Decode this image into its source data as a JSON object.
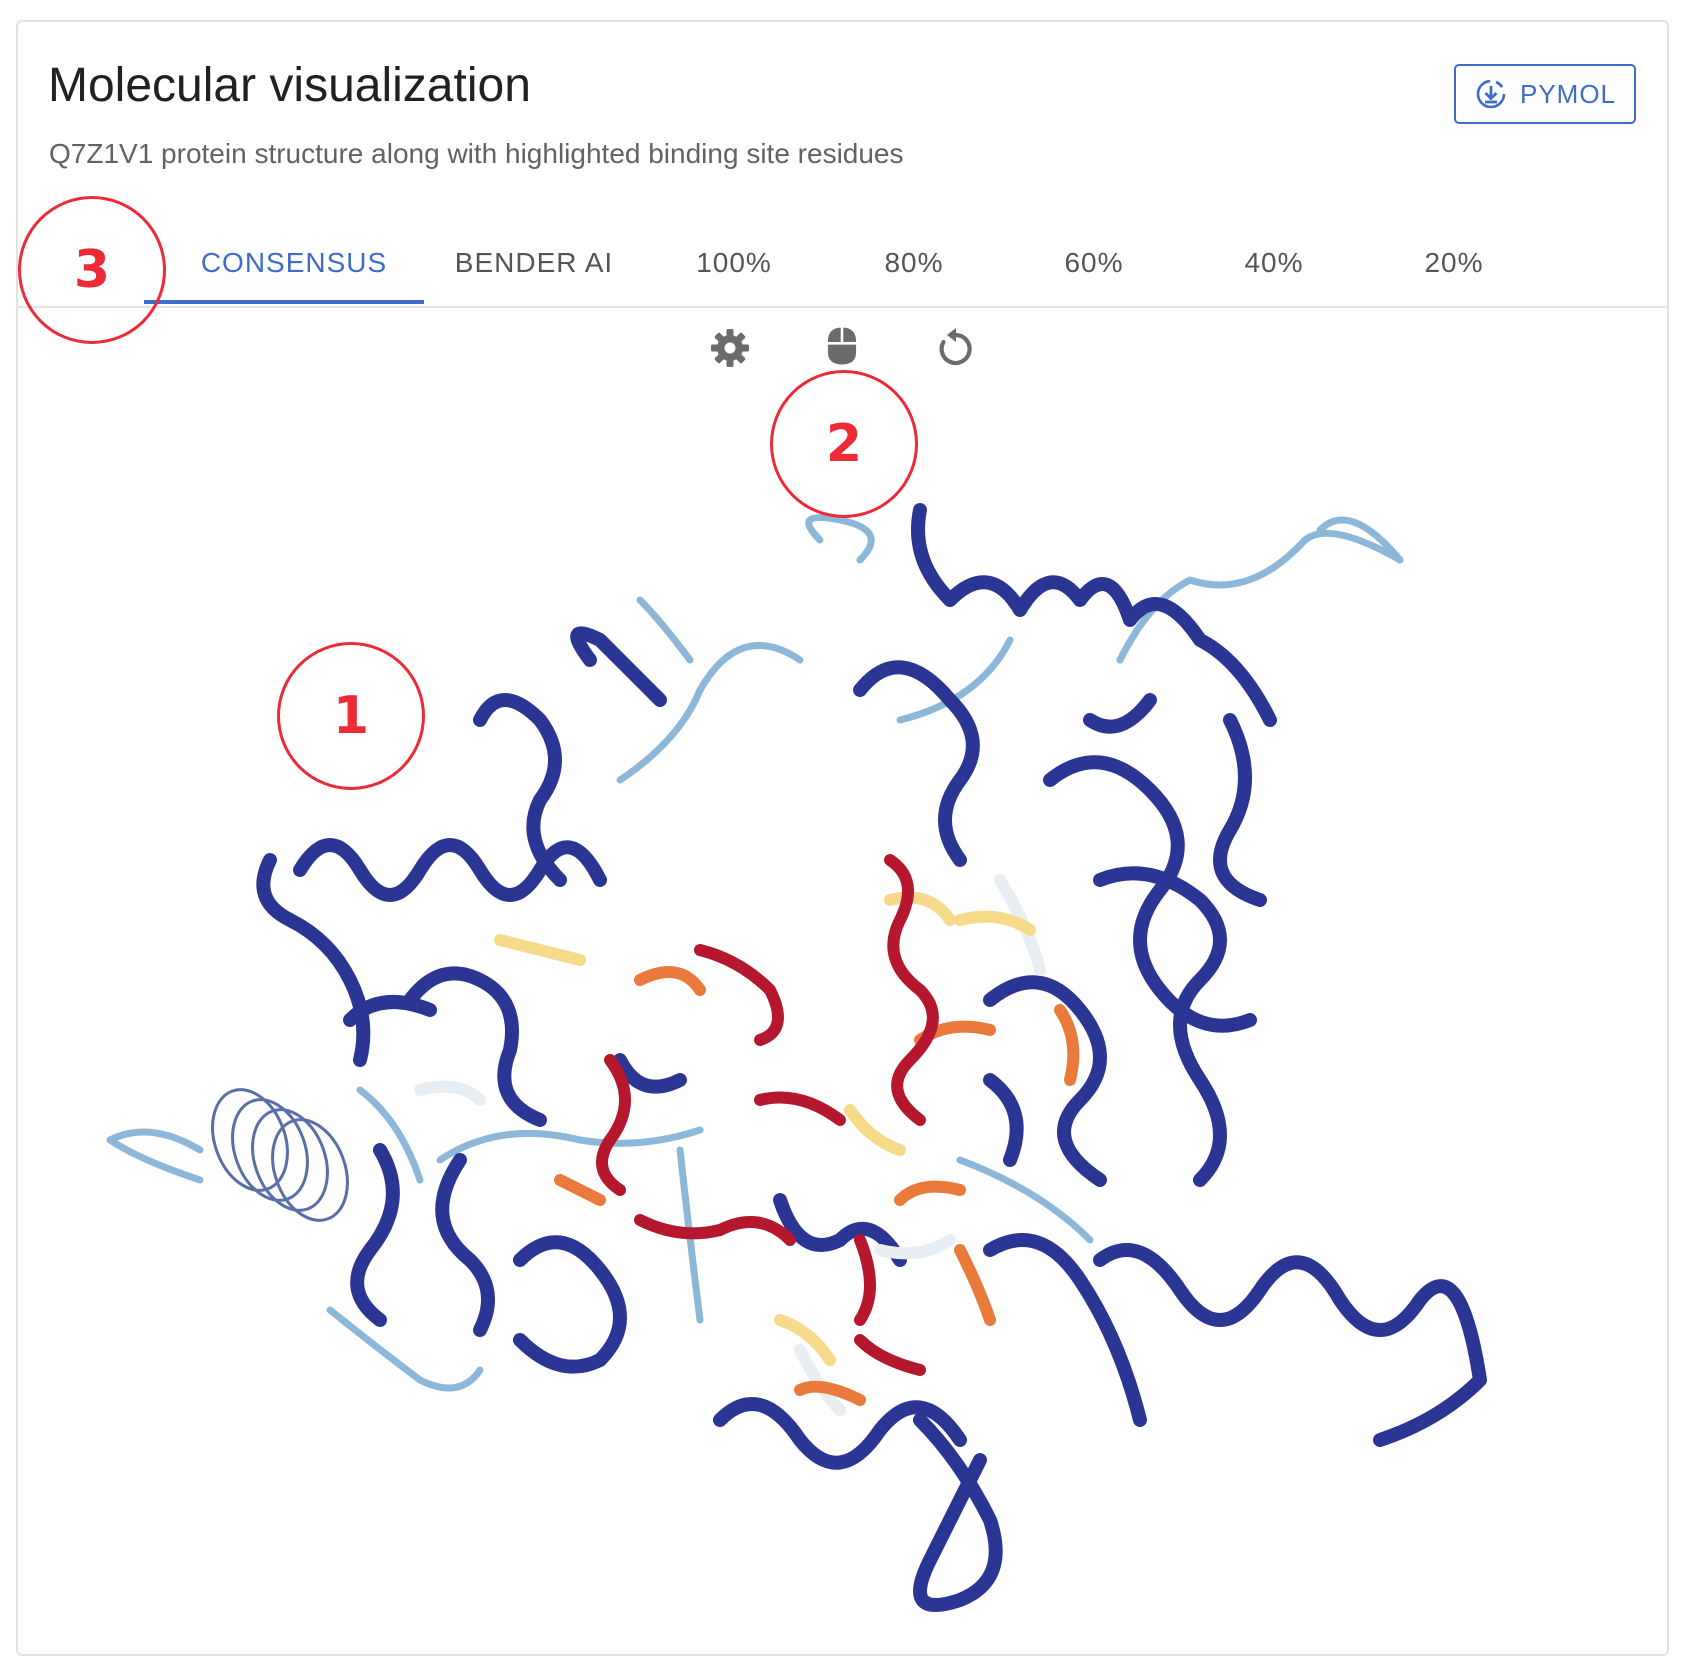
{
  "header": {
    "title": "Molecular visualization",
    "subtitle": "Q7Z1V1 protein structure along with highlighted binding site residues",
    "pymol_label": "PYMOL",
    "pymol_icon": "download-circle-icon"
  },
  "tabs": [
    {
      "label": "CONSENSUS",
      "active": true
    },
    {
      "label": "BENDER AI",
      "active": false
    },
    {
      "label": "100%",
      "active": false
    },
    {
      "label": "80%",
      "active": false
    },
    {
      "label": "60%",
      "active": false
    },
    {
      "label": "40%",
      "active": false
    },
    {
      "label": "20%",
      "active": false
    }
  ],
  "toolbar": {
    "settings_icon": "gear-icon",
    "mouse_icon": "mouse-icon",
    "reset_icon": "rotate-icon"
  },
  "annotations": [
    "1",
    "2",
    "3"
  ],
  "colors": {
    "accent": "#3f6cc9",
    "annotation": "#ee2a36",
    "ribbon_low": "#2b3593",
    "ribbon_mid_low": "#8db7d9",
    "ribbon_mid": "#e8eef2",
    "ribbon_mid_high": "#f7d98a",
    "ribbon_high_orange": "#ea7a3c",
    "ribbon_high": "#b5172e"
  }
}
